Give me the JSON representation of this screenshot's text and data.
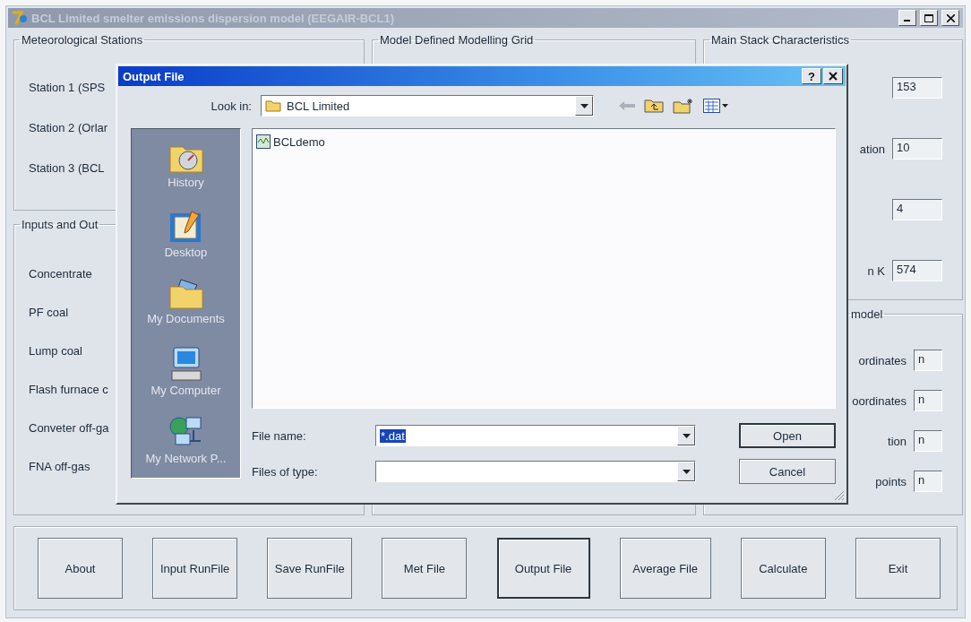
{
  "window": {
    "title": "BCL Limited smelter emissions dispersion model (EEGAIR-BCL1)"
  },
  "meteorological_stations": {
    "title": "Meteorological Stations",
    "stations": [
      "Station 1 (SPS",
      "Station 2 (Orlar",
      "Station 3 (BCL"
    ]
  },
  "inputs_and_outputs": {
    "title": "Inputs and Out",
    "items": [
      "Concentrate",
      "PF coal",
      "Lump coal",
      "Flash furnace c",
      "Conveter off-ga",
      "FNA off-gas"
    ]
  },
  "modelling_grid": {
    "title": "Model Defined Modelling Grid"
  },
  "main_stack": {
    "title": "Main Stack Characteristics",
    "fields": [
      {
        "value": "153"
      },
      {
        "label": "ation",
        "value": "10"
      },
      {
        "value": "4"
      },
      {
        "label": "n K",
        "value": "574"
      }
    ]
  },
  "model": {
    "title": "model",
    "fields": [
      {
        "label": "ordinates",
        "value": "n"
      },
      {
        "label": "oordinates",
        "value": "n"
      },
      {
        "label": "tion",
        "value": "n"
      },
      {
        "label": "points",
        "value": "n"
      }
    ]
  },
  "dialog": {
    "title": "Output File",
    "help": "?",
    "look_in": {
      "label": "Look in:",
      "value": "BCL Limited"
    },
    "places": [
      {
        "kind": "history",
        "label": "History"
      },
      {
        "kind": "desktop",
        "label": "Desktop"
      },
      {
        "kind": "documents",
        "label": "My Documents"
      },
      {
        "kind": "computer",
        "label": "My Computer"
      },
      {
        "kind": "network",
        "label": "My Network P..."
      }
    ],
    "files": [
      {
        "name": "BCLdemo"
      }
    ],
    "file_name": {
      "label": "File name:",
      "value": "*.dat",
      "selected": true
    },
    "file_type": {
      "label": "Files of type:"
    },
    "buttons": [
      {
        "label": "Open",
        "default": true
      },
      {
        "label": "Cancel",
        "default": false
      }
    ]
  },
  "buttons": [
    {
      "label": "About",
      "focused": false
    },
    {
      "label": "Input RunFile",
      "focused": false
    },
    {
      "label": "Save RunFile",
      "focused": false
    },
    {
      "label": "Met File",
      "focused": false
    },
    {
      "label": "Output File",
      "focused": true
    },
    {
      "label": "Average File",
      "focused": false
    },
    {
      "label": "Calculate",
      "focused": false
    },
    {
      "label": "Exit",
      "focused": false
    }
  ]
}
